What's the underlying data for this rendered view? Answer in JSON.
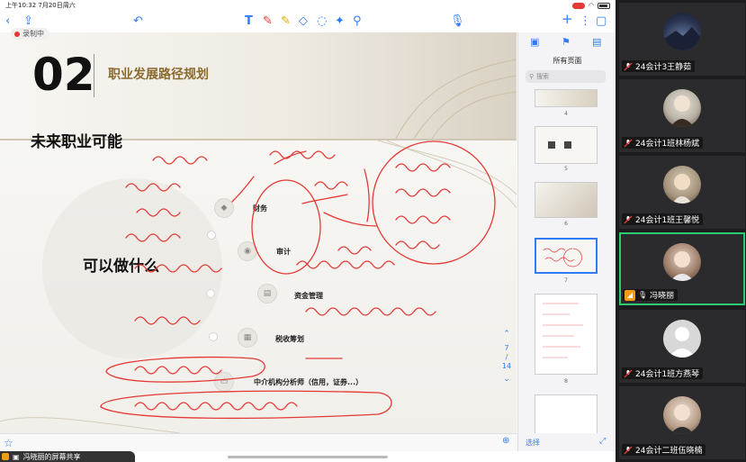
{
  "status_bar": {
    "time_date": "上午10:32  7月20日周六"
  },
  "toolbar": {
    "back_icon": "chevron-left-icon",
    "share_icon": "share-icon",
    "undo_icon": "undo-icon",
    "text_tool_icon": "text-icon",
    "pen_icon": "pen-icon",
    "highlighter_icon": "highlighter-icon",
    "eraser_icon": "eraser-icon",
    "lasso_icon": "lasso-icon",
    "mic_icon": "microphone-icon",
    "add_icon": "plus-icon"
  },
  "recording_label": "录制中",
  "slide": {
    "section_number": "02",
    "section_title": "职业发展路径规划",
    "future_heading": "未来职业可能",
    "center_text": "可以做什么",
    "labels": {
      "finance": "财务",
      "audit": "审计",
      "capital": "资金管理",
      "tax": "税收筹划",
      "analyst": "中介机构分析师（信用，证券...）"
    },
    "page_indicator_current": "7",
    "page_indicator_total": "14"
  },
  "page_panel": {
    "title": "所有页面",
    "search_placeholder": "搜索",
    "thumbnails": [
      "4",
      "5",
      "6",
      "7",
      "8"
    ],
    "selected_page": "7",
    "select_label": "选择"
  },
  "share_bar_text": "冯晓丽的屏幕共享",
  "participants": [
    {
      "name": "24会计3王静茹",
      "muted": true,
      "speaking": false
    },
    {
      "name": "24会计1班林杨斌",
      "muted": true,
      "speaking": false
    },
    {
      "name": "24会计1班王馨悦",
      "muted": true,
      "speaking": false
    },
    {
      "name": "冯晓丽",
      "muted": false,
      "speaking": true,
      "host": true
    },
    {
      "name": "24会计1班方燕琴",
      "muted": true,
      "speaking": false
    },
    {
      "name": "24会计二班伍晓楠",
      "muted": true,
      "speaking": false
    }
  ],
  "colors": {
    "accent": "#2f7cf6",
    "ink_red": "#e53935",
    "title_gold": "#8a6a2e",
    "active_speaker": "#2ecc71"
  }
}
